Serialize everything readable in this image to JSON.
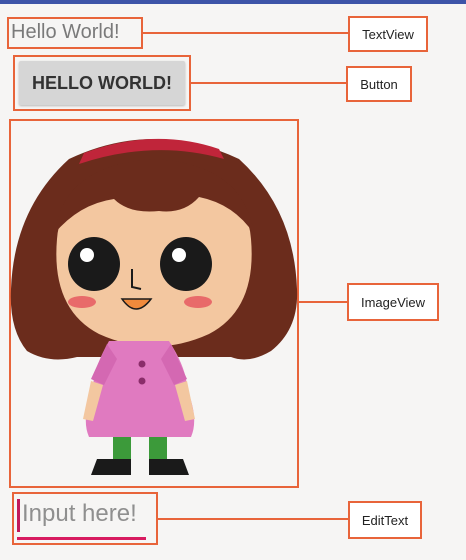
{
  "textview": {
    "text": "Hello World!",
    "label": "TextView"
  },
  "button": {
    "text": "HELLO WORLD!",
    "label": "Button"
  },
  "imageview": {
    "label": "ImageView"
  },
  "edittext": {
    "text": "Input here!",
    "label": "EditText"
  },
  "colors": {
    "outline": "#e8643a",
    "topbar": "#3d54a8",
    "edit_accent": "#d81b60"
  }
}
